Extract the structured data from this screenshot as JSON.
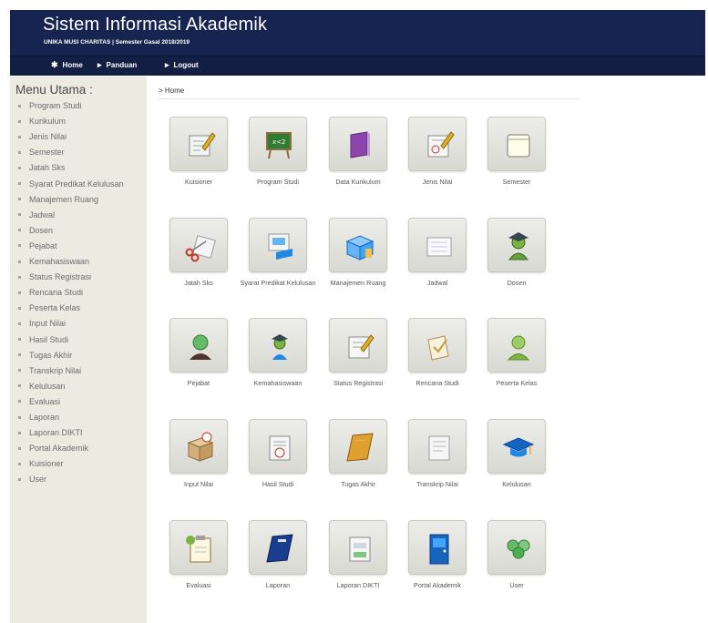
{
  "header": {
    "title": "Sistem Informasi Akademik",
    "subtitle": "UNIKA MUSI CHARITAS | Semester Gasal 2018/2019"
  },
  "navbar": [
    {
      "label": "Home",
      "icon": "home-icon"
    },
    {
      "label": "Panduan",
      "icon": "arrow-right-icon"
    },
    {
      "label": "Logout",
      "icon": "arrow-right-icon"
    }
  ],
  "sidebar": {
    "title": "Menu Utama :",
    "items": [
      "Program Studi",
      "Kurikulum",
      "Jenis Nilai",
      "Semester",
      "Jatah Sks",
      "Syarat Predikat Kelulusan",
      "Manajemen Ruang",
      "Jadwal",
      "Dosen",
      "Pejabat",
      "Kemahasiswaan",
      "Status Registrasi",
      "Rencana Studi",
      "Peserta Kelas",
      "Input Nilai",
      "Hasil Studi",
      "Tugas Akhir",
      "Transkrip Nilai",
      "Kelulusan",
      "Evaluasi",
      "Laporan",
      "Laporan DIKTI",
      "Portal Akademik",
      "Kuisioner",
      "User"
    ]
  },
  "breadcrumb": "> Home",
  "tiles": [
    {
      "label": "Kuisioner",
      "icon": "questionnaire-icon"
    },
    {
      "label": "Program Studi",
      "icon": "blackboard-icon"
    },
    {
      "label": "Data Kurikulum",
      "icon": "book-icon"
    },
    {
      "label": "Jenis Nilai",
      "icon": "graded-paper-icon"
    },
    {
      "label": "Semester",
      "icon": "calendar-icon"
    },
    {
      "label": "Jatah Sks",
      "icon": "scissors-icon"
    },
    {
      "label": "Syarat Predikat Kelulusan",
      "icon": "presentation-icon"
    },
    {
      "label": "Manajemen Ruang",
      "icon": "room-boxes-icon"
    },
    {
      "label": "Jadwal",
      "icon": "notepad-icon"
    },
    {
      "label": "Dosen",
      "icon": "lecturer-icon"
    },
    {
      "label": "Pejabat",
      "icon": "official-icon"
    },
    {
      "label": "Kemahasiswaan",
      "icon": "student-icon"
    },
    {
      "label": "Status Registrasi",
      "icon": "edit-document-icon"
    },
    {
      "label": "Rencana Studi",
      "icon": "study-plan-icon"
    },
    {
      "label": "Peserta Kelas",
      "icon": "class-participant-icon"
    },
    {
      "label": "Input Nilai",
      "icon": "input-box-icon"
    },
    {
      "label": "Hasil Studi",
      "icon": "result-document-icon"
    },
    {
      "label": "Tugas Akhir",
      "icon": "thesis-book-icon"
    },
    {
      "label": "Transkrip Nilai",
      "icon": "transcript-icon"
    },
    {
      "label": "Kelulusan",
      "icon": "graduation-cap-icon"
    },
    {
      "label": "Evaluasi",
      "icon": "clipboard-icon"
    },
    {
      "label": "Laporan",
      "icon": "report-book-icon"
    },
    {
      "label": "Laporan DIKTI",
      "icon": "dikti-report-icon"
    },
    {
      "label": "Portal Akademik",
      "icon": "portal-door-icon"
    },
    {
      "label": "User",
      "icon": "users-icon"
    }
  ]
}
